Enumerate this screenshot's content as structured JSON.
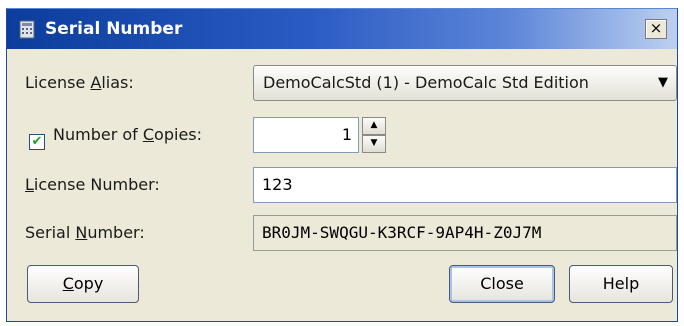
{
  "window": {
    "title": "Serial Number",
    "close_glyph": "×",
    "icon": "app-icon"
  },
  "fields": {
    "license_alias": {
      "label_pre": "License ",
      "label_mn": "A",
      "label_post": "lias:",
      "value": "DemoCalcStd (1) - DemoCalc Std Edition"
    },
    "copies": {
      "checked": true,
      "label_pre": "Number of ",
      "label_mn": "C",
      "label_post": "opies:",
      "value": "1"
    },
    "license_number": {
      "label_mn": "L",
      "label_post": "icense Number:",
      "value": "123"
    },
    "serial_number": {
      "label_pre": "Serial ",
      "label_mn": "N",
      "label_post": "umber:",
      "value": "BR0JM-SWQGU-K3RCF-9AP4H-Z0J7M"
    }
  },
  "buttons": {
    "copy_mn": "C",
    "copy_rest": "opy",
    "close": "Close",
    "help": "Help"
  },
  "colors": {
    "titlebar_start": "#0b3d9c",
    "titlebar_end": "#bcd0f0",
    "dialog_bg": "#ece9d8"
  }
}
